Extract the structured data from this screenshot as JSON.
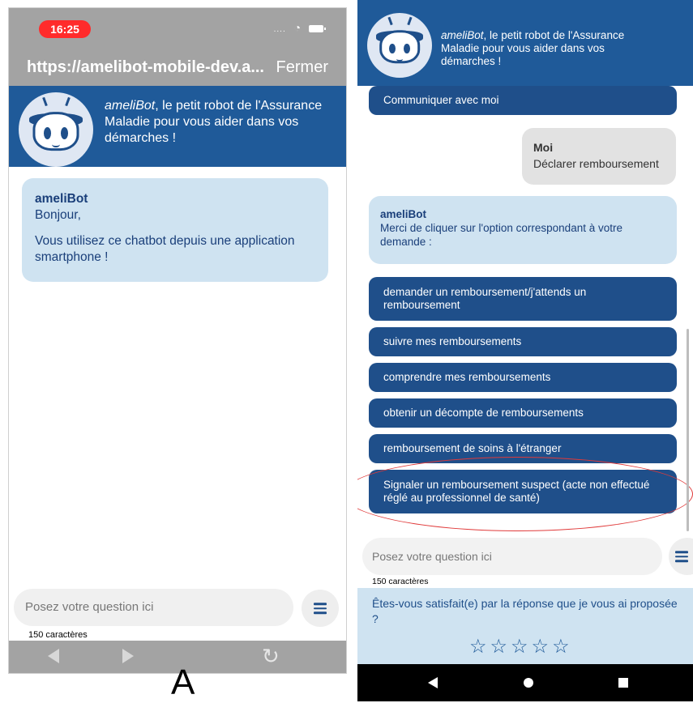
{
  "phone_a": {
    "status": {
      "time": "16:25"
    },
    "browser": {
      "url": "https://amelibot-mobile-dev.a...",
      "close_label": "Fermer"
    },
    "header": {
      "brand": "ameliBot",
      "tagline": ", le petit robot de l'Assurance Maladie pour vous aider dans vos démarches !"
    },
    "message": {
      "sender": "ameliBot",
      "greeting": "Bonjour,",
      "text": "Vous utilisez ce chatbot depuis une application smartphone !"
    },
    "input": {
      "placeholder": "Posez votre question ici",
      "counter": "150 caractères"
    },
    "label": "A"
  },
  "phone_b": {
    "header": {
      "brand": "ameliBot",
      "tagline": ", le petit robot de l'Assurance Maladie pour vous aider dans vos démarches !"
    },
    "top_option": "Communiquer avec moi",
    "user_message": {
      "sender": "Moi",
      "text": "Déclarer remboursement"
    },
    "bot_message": {
      "sender": "ameliBot",
      "text": "Merci de cliquer sur l'option correspondant à votre demande :"
    },
    "options": [
      "demander un remboursement/j'attends un remboursement",
      "suivre mes remboursements",
      "comprendre mes remboursements",
      "obtenir un décompte de remboursements",
      "remboursement de soins à l'étranger",
      "Signaler un remboursement suspect (acte non effectué réglé au professionnel de santé)"
    ],
    "input": {
      "placeholder": "Posez votre question ici",
      "counter": "150 caractères"
    },
    "satisfaction": {
      "question": "Êtes-vous satisfait(e) par la réponse que je vous ai proposée ?",
      "stars": "☆☆☆☆☆"
    }
  },
  "colors": {
    "brand_blue": "#1f5a99",
    "option_blue": "#1f4f8a",
    "bubble_bg": "#cfe3f1",
    "highlight": "#e03a3a"
  }
}
